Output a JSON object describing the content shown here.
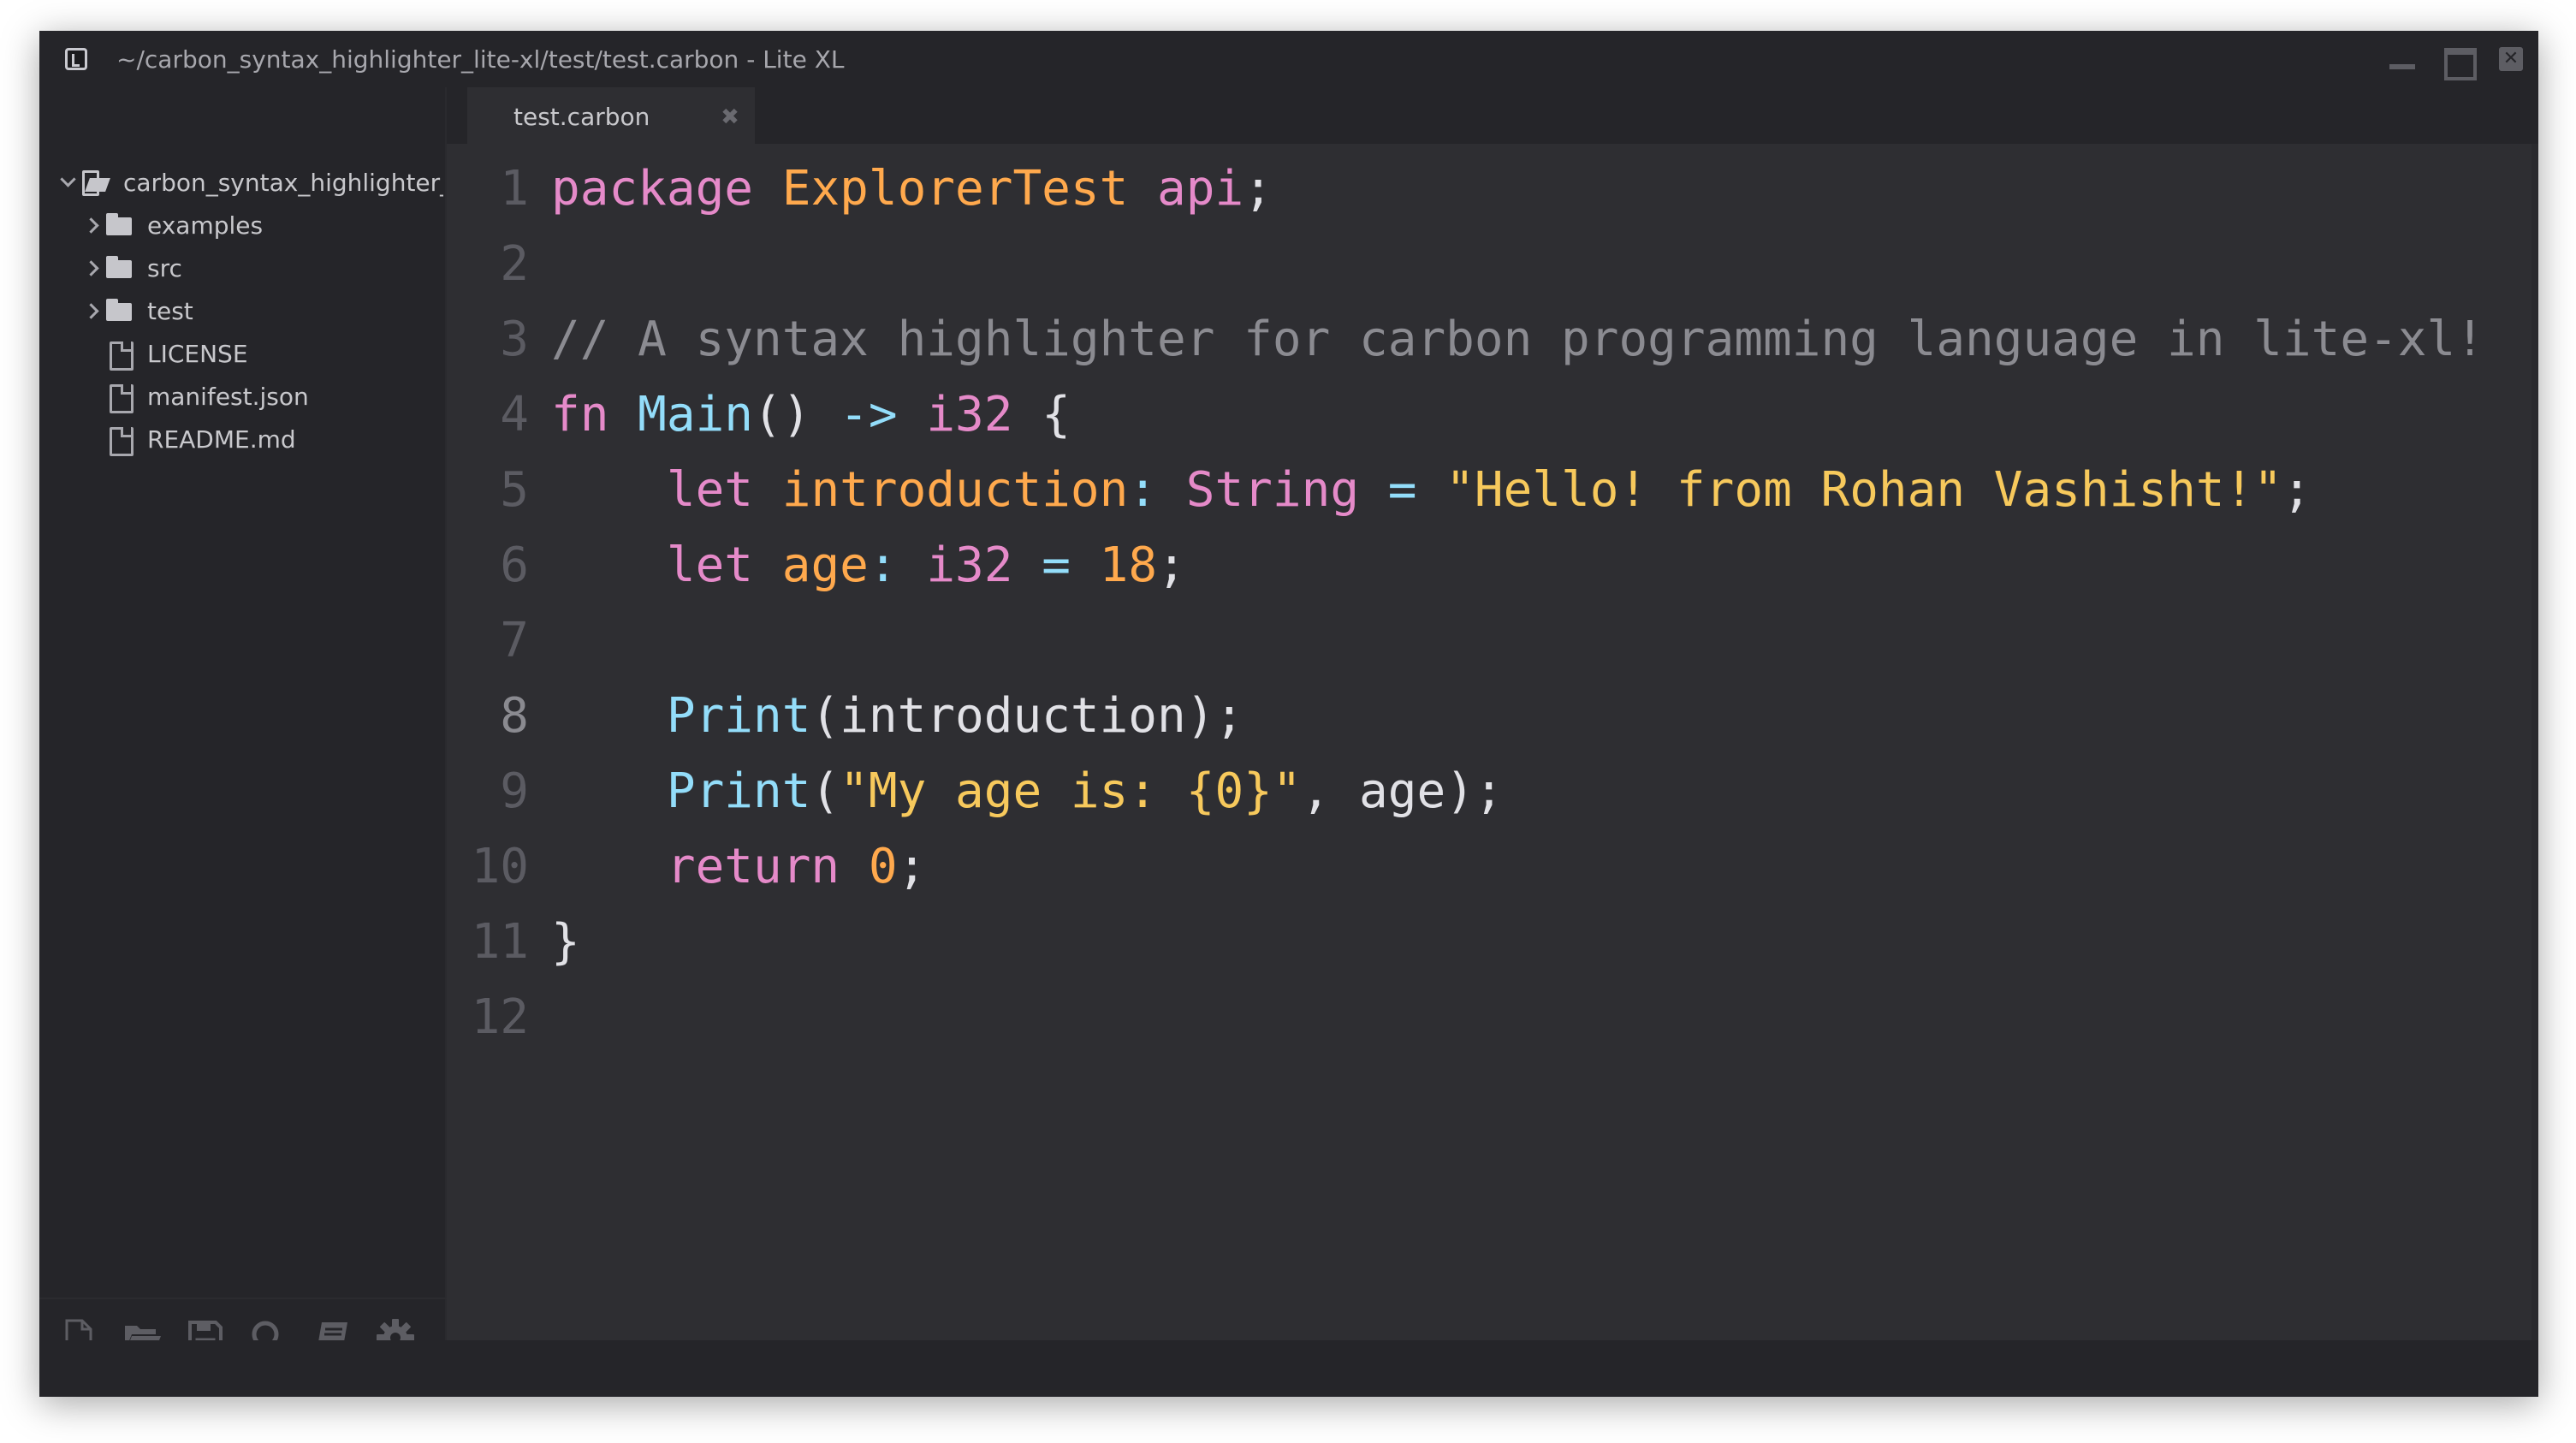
{
  "window": {
    "title": "~/carbon_syntax_highlighter_lite-xl/test/test.carbon - Lite XL"
  },
  "sidebar": {
    "root": {
      "label": "carbon_syntax_highlighter_",
      "icon": "folder-open-icon"
    },
    "items": [
      {
        "label": "examples",
        "type": "folder"
      },
      {
        "label": "src",
        "type": "folder"
      },
      {
        "label": "test",
        "type": "folder"
      },
      {
        "label": "LICENSE",
        "type": "file"
      },
      {
        "label": "manifest.json",
        "type": "file"
      },
      {
        "label": "README.md",
        "type": "file"
      }
    ],
    "toolbar": [
      "new-file-icon",
      "open-folder-icon",
      "save-icon",
      "search-icon",
      "book-icon",
      "settings-icon"
    ]
  },
  "tabs": [
    {
      "label": "test.carbon",
      "close": "✖"
    }
  ],
  "editor": {
    "line_numbers": [
      "1",
      "2",
      "3",
      "4",
      "5",
      "6",
      "7",
      "8",
      "9",
      "10",
      "11",
      "12"
    ],
    "lines": {
      "l1": {
        "kw": "package",
        "sp1": " ",
        "name": "ExplorerTest",
        "sp2": " ",
        "api": "api",
        "semi": ";"
      },
      "l3": {
        "comment": "// A syntax highlighter for carbon programming language in lite-xl!"
      },
      "l4": {
        "kw": "fn",
        "sp1": " ",
        "fn": "Main",
        "paren": "()",
        "sp2": " ",
        "arrow": "->",
        "sp3": " ",
        "type": "i32",
        "sp4": " ",
        "brace": "{"
      },
      "l5": {
        "indent": "    ",
        "kw": "let",
        "sp1": " ",
        "var": "introduction",
        "colon": ":",
        "sp2": " ",
        "type": "String",
        "sp3": " ",
        "eq": "=",
        "sp4": " ",
        "str": "\"Hello! from Rohan Vashisht!\"",
        "semi": ";"
      },
      "l6": {
        "indent": "    ",
        "kw": "let",
        "sp1": " ",
        "var": "age",
        "colon": ":",
        "sp2": " ",
        "type": "i32",
        "sp3": " ",
        "eq": "=",
        "sp4": " ",
        "num": "18",
        "semi": ";"
      },
      "l8": {
        "indent": "    ",
        "fn": "Print",
        "rest": "(introduction);"
      },
      "l9": {
        "indent": "    ",
        "fn": "Print",
        "open": "(",
        "str": "\"My age is: {0}\"",
        "rest": ", age);"
      },
      "l10": {
        "indent": "    ",
        "kw": "return",
        "sp1": " ",
        "num": "0",
        "semi": ";"
      },
      "l11": {
        "brace": "}"
      }
    }
  },
  "colors": {
    "background": "#2e2e32",
    "sidebar": "#252529",
    "keyword": "#e58ac9",
    "function": "#93ddfa",
    "string": "#f7c95c",
    "number": "#ffa94d",
    "comment": "#8b8b91"
  }
}
